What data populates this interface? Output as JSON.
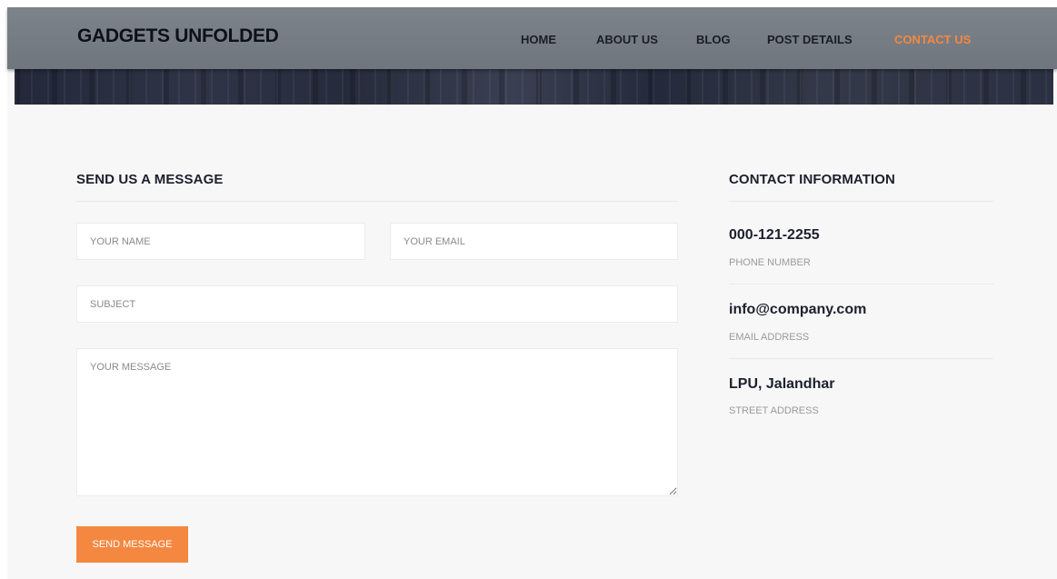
{
  "header": {
    "brand": "GADGETS UNFOLDED",
    "nav": [
      {
        "label": "HOME",
        "active": false
      },
      {
        "label": "ABOUT US",
        "active": false
      },
      {
        "label": "BLOG",
        "active": false
      },
      {
        "label": "POST DETAILS",
        "active": false
      },
      {
        "label": "CONTACT US",
        "active": true
      }
    ]
  },
  "form": {
    "title": "SEND US A MESSAGE",
    "name_placeholder": "YOUR NAME",
    "email_placeholder": "YOUR EMAIL",
    "subject_placeholder": "SUBJECT",
    "message_placeholder": "YOUR MESSAGE",
    "submit_label": "SEND MESSAGE"
  },
  "contact": {
    "title": "CONTACT INFORMATION",
    "items": [
      {
        "value": "000-121-2255",
        "caption": "PHONE NUMBER"
      },
      {
        "value": "info@company.com",
        "caption": "EMAIL ADDRESS"
      },
      {
        "value": "LPU, Jalandhar",
        "caption": "STREET ADDRESS"
      }
    ]
  },
  "colors": {
    "accent": "#f48840",
    "header_bg": "#767c84",
    "heading_text": "#1e1f2e",
    "caption_text": "#9a9a9a",
    "page_bg": "#f7f7f7"
  }
}
